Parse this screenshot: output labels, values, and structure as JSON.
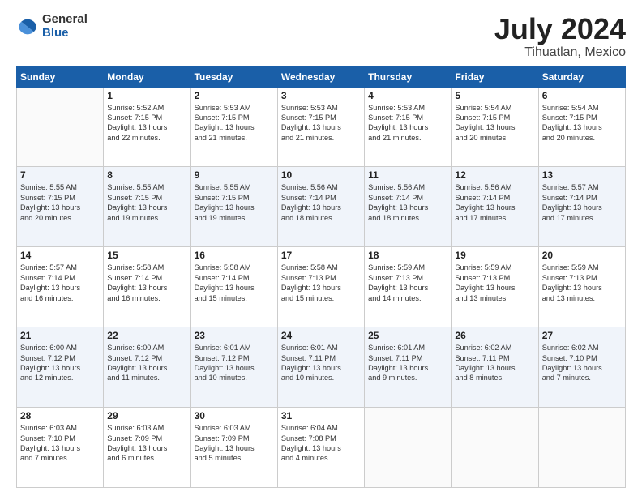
{
  "header": {
    "logo_general": "General",
    "logo_blue": "Blue",
    "month": "July 2024",
    "location": "Tihuatlan, Mexico"
  },
  "weekdays": [
    "Sunday",
    "Monday",
    "Tuesday",
    "Wednesday",
    "Thursday",
    "Friday",
    "Saturday"
  ],
  "weeks": [
    [
      {
        "day": "",
        "info": ""
      },
      {
        "day": "1",
        "info": "Sunrise: 5:52 AM\nSunset: 7:15 PM\nDaylight: 13 hours\nand 22 minutes."
      },
      {
        "day": "2",
        "info": "Sunrise: 5:53 AM\nSunset: 7:15 PM\nDaylight: 13 hours\nand 21 minutes."
      },
      {
        "day": "3",
        "info": "Sunrise: 5:53 AM\nSunset: 7:15 PM\nDaylight: 13 hours\nand 21 minutes."
      },
      {
        "day": "4",
        "info": "Sunrise: 5:53 AM\nSunset: 7:15 PM\nDaylight: 13 hours\nand 21 minutes."
      },
      {
        "day": "5",
        "info": "Sunrise: 5:54 AM\nSunset: 7:15 PM\nDaylight: 13 hours\nand 20 minutes."
      },
      {
        "day": "6",
        "info": "Sunrise: 5:54 AM\nSunset: 7:15 PM\nDaylight: 13 hours\nand 20 minutes."
      }
    ],
    [
      {
        "day": "7",
        "info": "Sunrise: 5:55 AM\nSunset: 7:15 PM\nDaylight: 13 hours\nand 20 minutes."
      },
      {
        "day": "8",
        "info": "Sunrise: 5:55 AM\nSunset: 7:15 PM\nDaylight: 13 hours\nand 19 minutes."
      },
      {
        "day": "9",
        "info": "Sunrise: 5:55 AM\nSunset: 7:15 PM\nDaylight: 13 hours\nand 19 minutes."
      },
      {
        "day": "10",
        "info": "Sunrise: 5:56 AM\nSunset: 7:14 PM\nDaylight: 13 hours\nand 18 minutes."
      },
      {
        "day": "11",
        "info": "Sunrise: 5:56 AM\nSunset: 7:14 PM\nDaylight: 13 hours\nand 18 minutes."
      },
      {
        "day": "12",
        "info": "Sunrise: 5:56 AM\nSunset: 7:14 PM\nDaylight: 13 hours\nand 17 minutes."
      },
      {
        "day": "13",
        "info": "Sunrise: 5:57 AM\nSunset: 7:14 PM\nDaylight: 13 hours\nand 17 minutes."
      }
    ],
    [
      {
        "day": "14",
        "info": "Sunrise: 5:57 AM\nSunset: 7:14 PM\nDaylight: 13 hours\nand 16 minutes."
      },
      {
        "day": "15",
        "info": "Sunrise: 5:58 AM\nSunset: 7:14 PM\nDaylight: 13 hours\nand 16 minutes."
      },
      {
        "day": "16",
        "info": "Sunrise: 5:58 AM\nSunset: 7:14 PM\nDaylight: 13 hours\nand 15 minutes."
      },
      {
        "day": "17",
        "info": "Sunrise: 5:58 AM\nSunset: 7:13 PM\nDaylight: 13 hours\nand 15 minutes."
      },
      {
        "day": "18",
        "info": "Sunrise: 5:59 AM\nSunset: 7:13 PM\nDaylight: 13 hours\nand 14 minutes."
      },
      {
        "day": "19",
        "info": "Sunrise: 5:59 AM\nSunset: 7:13 PM\nDaylight: 13 hours\nand 13 minutes."
      },
      {
        "day": "20",
        "info": "Sunrise: 5:59 AM\nSunset: 7:13 PM\nDaylight: 13 hours\nand 13 minutes."
      }
    ],
    [
      {
        "day": "21",
        "info": "Sunrise: 6:00 AM\nSunset: 7:12 PM\nDaylight: 13 hours\nand 12 minutes."
      },
      {
        "day": "22",
        "info": "Sunrise: 6:00 AM\nSunset: 7:12 PM\nDaylight: 13 hours\nand 11 minutes."
      },
      {
        "day": "23",
        "info": "Sunrise: 6:01 AM\nSunset: 7:12 PM\nDaylight: 13 hours\nand 10 minutes."
      },
      {
        "day": "24",
        "info": "Sunrise: 6:01 AM\nSunset: 7:11 PM\nDaylight: 13 hours\nand 10 minutes."
      },
      {
        "day": "25",
        "info": "Sunrise: 6:01 AM\nSunset: 7:11 PM\nDaylight: 13 hours\nand 9 minutes."
      },
      {
        "day": "26",
        "info": "Sunrise: 6:02 AM\nSunset: 7:11 PM\nDaylight: 13 hours\nand 8 minutes."
      },
      {
        "day": "27",
        "info": "Sunrise: 6:02 AM\nSunset: 7:10 PM\nDaylight: 13 hours\nand 7 minutes."
      }
    ],
    [
      {
        "day": "28",
        "info": "Sunrise: 6:03 AM\nSunset: 7:10 PM\nDaylight: 13 hours\nand 7 minutes."
      },
      {
        "day": "29",
        "info": "Sunrise: 6:03 AM\nSunset: 7:09 PM\nDaylight: 13 hours\nand 6 minutes."
      },
      {
        "day": "30",
        "info": "Sunrise: 6:03 AM\nSunset: 7:09 PM\nDaylight: 13 hours\nand 5 minutes."
      },
      {
        "day": "31",
        "info": "Sunrise: 6:04 AM\nSunset: 7:08 PM\nDaylight: 13 hours\nand 4 minutes."
      },
      {
        "day": "",
        "info": ""
      },
      {
        "day": "",
        "info": ""
      },
      {
        "day": "",
        "info": ""
      }
    ]
  ]
}
